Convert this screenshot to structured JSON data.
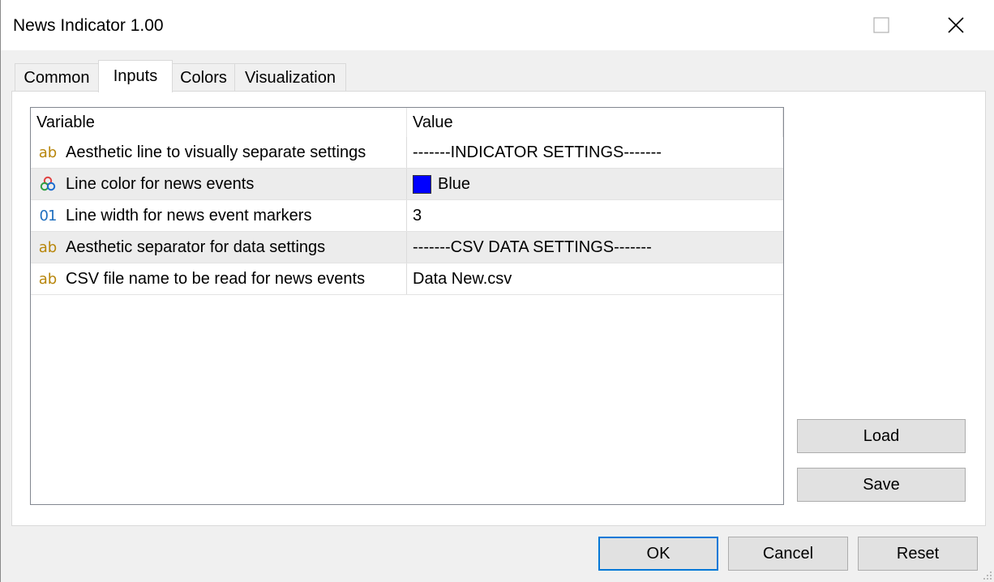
{
  "window": {
    "title": "News Indicator 1.00"
  },
  "tabs": [
    {
      "label": "Common"
    },
    {
      "label": "Inputs",
      "active": true
    },
    {
      "label": "Colors"
    },
    {
      "label": "Visualization"
    }
  ],
  "grid": {
    "columns": [
      "Variable",
      "Value"
    ],
    "rows": [
      {
        "icon": "string-type-icon",
        "variable": "Aesthetic line to visually separate settings",
        "value": "-------INDICATOR SETTINGS-------"
      },
      {
        "icon": "color-type-icon",
        "variable": "Line color for news events",
        "value": "Blue",
        "swatch_color": "#0000ff"
      },
      {
        "icon": "integer-type-icon",
        "variable": "Line width for news event markers",
        "value": "3"
      },
      {
        "icon": "string-type-icon",
        "variable": "Aesthetic separator for data settings",
        "value": "-------CSV DATA SETTINGS-------"
      },
      {
        "icon": "string-type-icon",
        "variable": "CSV file name to be read for news events",
        "value": "Data New.csv"
      }
    ]
  },
  "buttons": {
    "load": "Load",
    "save": "Save",
    "ok": "OK",
    "cancel": "Cancel",
    "reset": "Reset"
  },
  "icons": {
    "string": "ab",
    "integer": "01"
  },
  "colors": {
    "accent": "#0078d7",
    "swatch_blue": "#0000ff"
  }
}
